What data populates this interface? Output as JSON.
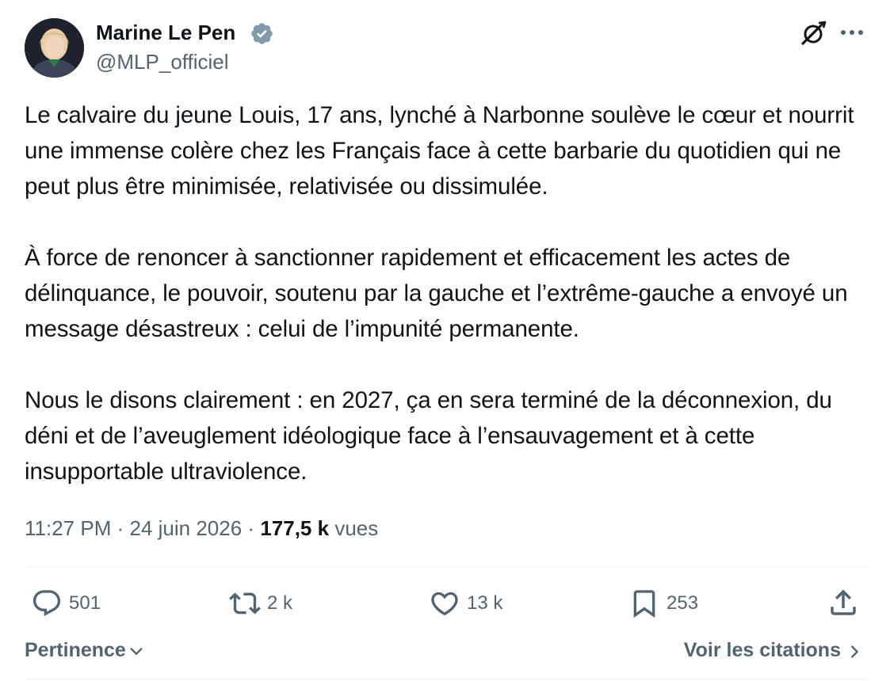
{
  "author": {
    "name": "Marine Le Pen",
    "handle": "@MLP_officiel",
    "verified": true
  },
  "tweet": {
    "paragraphs": [
      "Le calvaire du jeune Louis, 17 ans, lynché à Narbonne soulève le cœur et nourrit une immense colère chez les Français face à cette barbarie du quotidien qui ne peut plus être minimisée, relativisée ou dissimulée.",
      "À force de renoncer à sanctionner rapidement et efficacement les actes de délinquance, le pouvoir, soutenu par la gauche et l’extrême-gauche a envoyé un message désastreux : celui de l’impunité permanente.",
      "Nous le disons clairement : en 2027, ça en sera terminé de la déconnexion, du déni et de l’aveuglement idéologique face à l’ensauvagement et à cette insupportable ultraviolence."
    ]
  },
  "meta": {
    "time": "11:27 PM",
    "separator": "·",
    "date": "24 juin 2026",
    "views_count": "177,5 k",
    "views_label": "vues"
  },
  "actions": {
    "replies": "501",
    "reposts": "2 k",
    "likes": "13 k",
    "bookmarks": "253"
  },
  "footer": {
    "sort_label": "Pertinence",
    "quotes_label": "Voir les citations"
  },
  "icons": {
    "verified": "verified-badge-icon",
    "grok": "grok-icon",
    "more": "more-icon",
    "reply": "reply-icon",
    "repost": "repost-icon",
    "like": "heart-icon",
    "bookmark": "bookmark-icon",
    "share": "share-icon"
  },
  "colors": {
    "text": "#0f1419",
    "secondary": "#536471",
    "divider": "#eff3f4",
    "verified_badge": "#829aab"
  }
}
